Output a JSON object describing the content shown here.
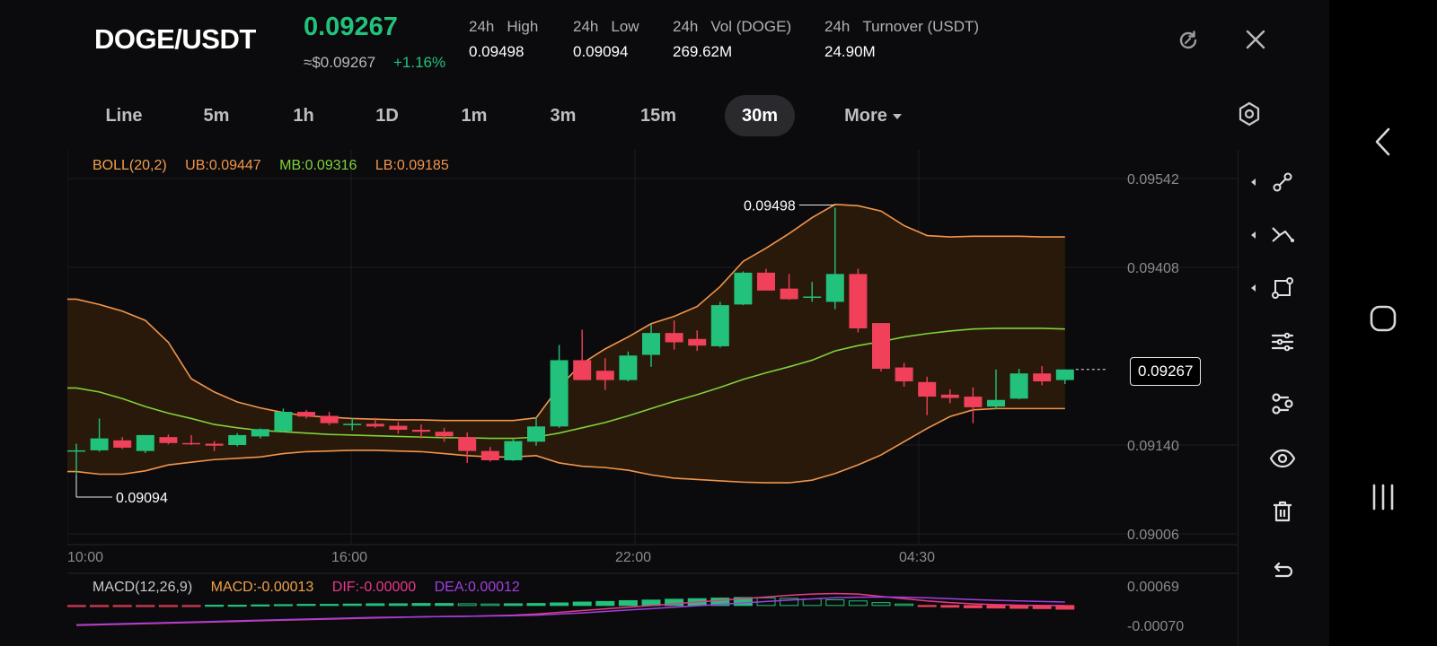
{
  "header": {
    "pair": "DOGE/USDT",
    "price": "0.09267",
    "approx_price": "≈$0.09267",
    "change": "+1.16%",
    "stats": [
      {
        "label_a": "24h",
        "label_b": "High",
        "value": "0.09498"
      },
      {
        "label_a": "24h",
        "label_b": "Low",
        "value": "0.09094"
      },
      {
        "label_a": "24h",
        "label_b": "Vol (DOGE)",
        "value": "269.62M"
      },
      {
        "label_a": "24h",
        "label_b": "Turnover (USDT)",
        "value": "24.90M"
      }
    ],
    "icons": {
      "refresh": "refresh-icon",
      "close": "close-icon"
    }
  },
  "tabs": [
    "Line",
    "5m",
    "1h",
    "1D",
    "1m",
    "3m",
    "15m",
    "30m",
    "More"
  ],
  "active_tab": "30m",
  "boll_legend": {
    "name": "BOLL(20,2)",
    "ub": "UB:0.09447",
    "mb": "MB:0.09316",
    "lb": "LB:0.09185"
  },
  "macd_legend": {
    "name": "MACD(12,26,9)",
    "macd": "MACD:-0.00013",
    "dif": "DIF:-0.00000",
    "dea": "DEA:0.00012"
  },
  "current_price_tag": "0.09267",
  "colors": {
    "up": "#22c27c",
    "down": "#f0405a",
    "ub": "#f3954a",
    "mb": "#7fd23a",
    "lb": "#f3954a",
    "dif": "#e83a8a",
    "dea": "#a040e0",
    "legend_name": "#f3a14a"
  },
  "chart_data": {
    "type": "candlestick",
    "timeframe": "30m",
    "x_tick_labels": [
      "10:00",
      "16:00",
      "22:00",
      "04:30"
    ],
    "y_tick_labels": [
      "0.09542",
      "0.09408",
      "0.09140",
      "0.09006"
    ],
    "ylim": [
      0.09006,
      0.09542
    ],
    "high_marker": "0.09498",
    "low_marker": "0.09094",
    "candles": [
      {
        "o": 0.0913,
        "h": 0.09142,
        "l": 0.09094,
        "c": 0.09132
      },
      {
        "o": 0.09132,
        "h": 0.0918,
        "l": 0.0913,
        "c": 0.0915
      },
      {
        "o": 0.09147,
        "h": 0.09152,
        "l": 0.09134,
        "c": 0.09136
      },
      {
        "o": 0.09131,
        "h": 0.09155,
        "l": 0.09128,
        "c": 0.09155
      },
      {
        "o": 0.09152,
        "h": 0.09156,
        "l": 0.09141,
        "c": 0.09143
      },
      {
        "o": 0.09143,
        "h": 0.09155,
        "l": 0.0914,
        "c": 0.09142
      },
      {
        "o": 0.09142,
        "h": 0.09146,
        "l": 0.09131,
        "c": 0.09139
      },
      {
        "o": 0.0914,
        "h": 0.09158,
        "l": 0.09138,
        "c": 0.09155
      },
      {
        "o": 0.09153,
        "h": 0.09165,
        "l": 0.0915,
        "c": 0.09164
      },
      {
        "o": 0.09161,
        "h": 0.09195,
        "l": 0.09159,
        "c": 0.0919
      },
      {
        "o": 0.0919,
        "h": 0.09193,
        "l": 0.0918,
        "c": 0.09183
      },
      {
        "o": 0.09184,
        "h": 0.0919,
        "l": 0.0917,
        "c": 0.09173
      },
      {
        "o": 0.09171,
        "h": 0.09181,
        "l": 0.09162,
        "c": 0.09172
      },
      {
        "o": 0.09172,
        "h": 0.09181,
        "l": 0.09166,
        "c": 0.09168
      },
      {
        "o": 0.09169,
        "h": 0.09175,
        "l": 0.09157,
        "c": 0.09163
      },
      {
        "o": 0.09163,
        "h": 0.09171,
        "l": 0.0915,
        "c": 0.0916
      },
      {
        "o": 0.0916,
        "h": 0.09166,
        "l": 0.09145,
        "c": 0.09153
      },
      {
        "o": 0.09152,
        "h": 0.09159,
        "l": 0.09113,
        "c": 0.09131
      },
      {
        "o": 0.09131,
        "h": 0.09137,
        "l": 0.09115,
        "c": 0.09117
      },
      {
        "o": 0.09117,
        "h": 0.09149,
        "l": 0.09116,
        "c": 0.09146
      },
      {
        "o": 0.09145,
        "h": 0.09182,
        "l": 0.09139,
        "c": 0.09168
      },
      {
        "o": 0.09168,
        "h": 0.09291,
        "l": 0.09166,
        "c": 0.09268
      },
      {
        "o": 0.09268,
        "h": 0.09314,
        "l": 0.09249,
        "c": 0.09238
      },
      {
        "o": 0.09252,
        "h": 0.09271,
        "l": 0.09223,
        "c": 0.09238
      },
      {
        "o": 0.09238,
        "h": 0.09281,
        "l": 0.09236,
        "c": 0.09275
      },
      {
        "o": 0.09276,
        "h": 0.09322,
        "l": 0.09258,
        "c": 0.09309
      },
      {
        "o": 0.09309,
        "h": 0.09328,
        "l": 0.09284,
        "c": 0.09295
      },
      {
        "o": 0.093,
        "h": 0.09313,
        "l": 0.09282,
        "c": 0.0929
      },
      {
        "o": 0.09289,
        "h": 0.09356,
        "l": 0.09287,
        "c": 0.09351
      },
      {
        "o": 0.09352,
        "h": 0.09402,
        "l": 0.09351,
        "c": 0.094
      },
      {
        "o": 0.094,
        "h": 0.09406,
        "l": 0.09376,
        "c": 0.09373
      },
      {
        "o": 0.09376,
        "h": 0.09398,
        "l": 0.09359,
        "c": 0.0936
      },
      {
        "o": 0.09364,
        "h": 0.09386,
        "l": 0.09356,
        "c": 0.09364
      },
      {
        "o": 0.09356,
        "h": 0.09498,
        "l": 0.09345,
        "c": 0.09398
      },
      {
        "o": 0.09398,
        "h": 0.09406,
        "l": 0.0931,
        "c": 0.09316
      },
      {
        "o": 0.09324,
        "h": 0.09324,
        "l": 0.09251,
        "c": 0.09255
      },
      {
        "o": 0.09257,
        "h": 0.09264,
        "l": 0.09228,
        "c": 0.09236
      },
      {
        "o": 0.09235,
        "h": 0.09243,
        "l": 0.09185,
        "c": 0.09213
      },
      {
        "o": 0.09216,
        "h": 0.09224,
        "l": 0.09203,
        "c": 0.09211
      },
      {
        "o": 0.09213,
        "h": 0.09227,
        "l": 0.09173,
        "c": 0.09197
      },
      {
        "o": 0.09198,
        "h": 0.09254,
        "l": 0.09194,
        "c": 0.09208
      },
      {
        "o": 0.0921,
        "h": 0.09255,
        "l": 0.09209,
        "c": 0.09248
      },
      {
        "o": 0.09248,
        "h": 0.09259,
        "l": 0.0923,
        "c": 0.09236
      },
      {
        "o": 0.09238,
        "h": 0.09254,
        "l": 0.09232,
        "c": 0.09254
      }
    ],
    "boll_ub": [
      0.0936,
      0.09352,
      0.09342,
      0.09328,
      0.09295,
      0.0924,
      0.0922,
      0.09205,
      0.09196,
      0.09189,
      0.09184,
      0.09182,
      0.0918,
      0.09179,
      0.09178,
      0.09178,
      0.09177,
      0.09177,
      0.09177,
      0.09177,
      0.09181,
      0.09228,
      0.09263,
      0.09285,
      0.09303,
      0.09323,
      0.09334,
      0.09349,
      0.09379,
      0.09417,
      0.09437,
      0.09459,
      0.09483,
      0.09503,
      0.09501,
      0.09493,
      0.09471,
      0.09456,
      0.09454,
      0.09455,
      0.09455,
      0.09455,
      0.09454,
      0.09454
    ],
    "boll_mb": [
      0.09226,
      0.0922,
      0.0921,
      0.09198,
      0.09188,
      0.0918,
      0.09171,
      0.09166,
      0.09162,
      0.0916,
      0.09158,
      0.09156,
      0.09155,
      0.09154,
      0.09153,
      0.09152,
      0.09151,
      0.09151,
      0.0915,
      0.0915,
      0.09152,
      0.09158,
      0.09166,
      0.09174,
      0.09184,
      0.09195,
      0.09206,
      0.09216,
      0.09227,
      0.09239,
      0.09249,
      0.09258,
      0.09268,
      0.09282,
      0.0929,
      0.09296,
      0.09303,
      0.09308,
      0.09312,
      0.09315,
      0.09316,
      0.09316,
      0.09316,
      0.09315
    ],
    "boll_lb": [
      0.091,
      0.09096,
      0.09096,
      0.09101,
      0.0911,
      0.09114,
      0.09118,
      0.0912,
      0.09122,
      0.09127,
      0.0913,
      0.09131,
      0.09132,
      0.09132,
      0.09131,
      0.0913,
      0.09127,
      0.09124,
      0.09122,
      0.09122,
      0.09124,
      0.09113,
      0.09108,
      0.09106,
      0.09102,
      0.09095,
      0.0909,
      0.09088,
      0.09086,
      0.09084,
      0.09083,
      0.09083,
      0.09087,
      0.09097,
      0.0911,
      0.09125,
      0.09145,
      0.09165,
      0.09183,
      0.09193,
      0.09195,
      0.09195,
      0.09195,
      0.09195
    ],
    "macd_ylim": [
      -0.0007,
      0.00069
    ],
    "macd_y_tick_labels": [
      "0.00069",
      "-0.00070"
    ],
    "macd_hist": [
      -2e-05,
      -2e-05,
      -2e-05,
      -2e-05,
      -2e-05,
      -2e-05,
      1e-05,
      1e-05,
      2e-05,
      3e-05,
      4e-05,
      4e-05,
      5e-05,
      6e-05,
      6e-05,
      7e-05,
      7e-05,
      6e-05,
      5e-05,
      6e-05,
      7e-05,
      9e-05,
      0.00012,
      0.00014,
      0.00017,
      0.00019,
      0.00022,
      0.00024,
      0.00026,
      0.00028,
      0.00027,
      0.00025,
      0.00023,
      0.0002,
      0.00016,
      0.0001,
      5e-05,
      -2e-05,
      -6e-05,
      -8e-05,
      -9e-05,
      -0.0001,
      -0.00011,
      -0.00013
    ],
    "macd_dif": [
      -0.0007,
      -0.00068,
      -0.00066,
      -0.00064,
      -0.00062,
      -0.0006,
      -0.00058,
      -0.00056,
      -0.00054,
      -0.00052,
      -0.0005,
      -0.00048,
      -0.00046,
      -0.00044,
      -0.00042,
      -0.0004,
      -0.00039,
      -0.00038,
      -0.00036,
      -0.00034,
      -0.0003,
      -0.00024,
      -0.00018,
      -0.00012,
      -6e-05,
      0.0,
      6e-05,
      0.00012,
      0.00018,
      0.00024,
      0.0003,
      0.00036,
      0.0004,
      0.00042,
      0.0004,
      0.00032,
      0.00024,
      0.00016,
      0.0001,
      6e-05,
      3e-05,
      1e-05,
      0.0,
      0.0
    ],
    "macd_dea": [
      -0.00068,
      -0.00066,
      -0.00064,
      -0.00062,
      -0.0006,
      -0.00058,
      -0.00056,
      -0.00054,
      -0.00052,
      -0.0005,
      -0.00048,
      -0.00046,
      -0.00044,
      -0.00042,
      -0.00041,
      -0.0004,
      -0.00039,
      -0.00038,
      -0.00037,
      -0.00036,
      -0.00034,
      -0.0003,
      -0.00026,
      -0.00021,
      -0.00016,
      -0.00011,
      -6e-05,
      -1e-05,
      4e-05,
      9e-05,
      0.00014,
      0.00019,
      0.00023,
      0.00027,
      0.00029,
      0.0003,
      0.00029,
      0.00027,
      0.00024,
      0.00021,
      0.00018,
      0.00016,
      0.00014,
      0.00012
    ]
  },
  "toolbar_icons": [
    "trendline-icon",
    "multiline-icon",
    "shape-icon",
    "settings-sliders-icon",
    "indicator-icon",
    "eye-icon",
    "trash-icon",
    "undo-icon"
  ],
  "nav_icons": [
    "back-icon",
    "home-icon",
    "recent-apps-icon"
  ]
}
